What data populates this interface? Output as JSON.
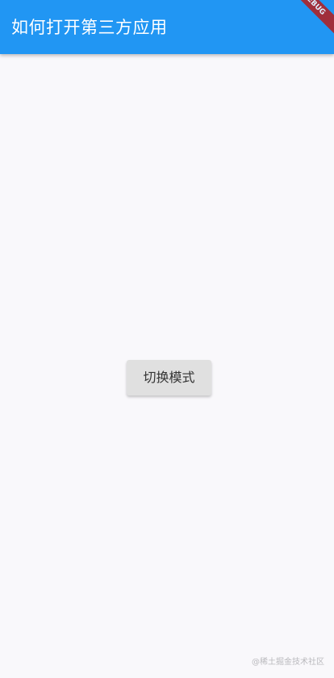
{
  "app_bar": {
    "title": "如何打开第三方应用",
    "background_color": "#2196f3",
    "debug_banner_label": "DEBUG"
  },
  "main": {
    "button_label": "切换模式"
  },
  "watermark": {
    "text": "@稀土掘金技术社区"
  }
}
